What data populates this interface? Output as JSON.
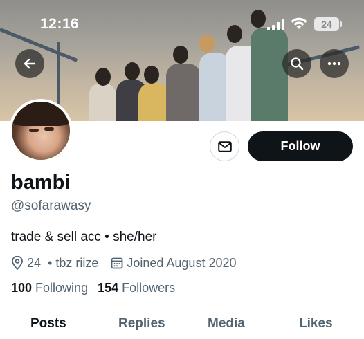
{
  "status_bar": {
    "time": "12:16",
    "battery": "24"
  },
  "header": {
    "back_icon": "arrow-left-icon",
    "search_icon": "search-icon",
    "more_icon": "more-horizontal-icon"
  },
  "actions": {
    "message_icon": "envelope-icon",
    "follow_label": "Follow"
  },
  "profile": {
    "display_name": "bambi",
    "handle": "@sofarawasy",
    "bio": "trade & sell acc • she/her",
    "location": "24",
    "location_extra": "• tbz riize",
    "joined": "Joined August 2020",
    "following_count": "100",
    "following_label": "Following",
    "followers_count": "154",
    "followers_label": "Followers"
  },
  "tabs": [
    {
      "label": "Posts",
      "active": true
    },
    {
      "label": "Replies",
      "active": false
    },
    {
      "label": "Media",
      "active": false
    },
    {
      "label": "Likes",
      "active": false
    }
  ],
  "colors": {
    "text_primary": "#0f1419",
    "text_secondary": "#536471",
    "follow_button_bg": "#0f1419",
    "border": "#cfd9de"
  }
}
